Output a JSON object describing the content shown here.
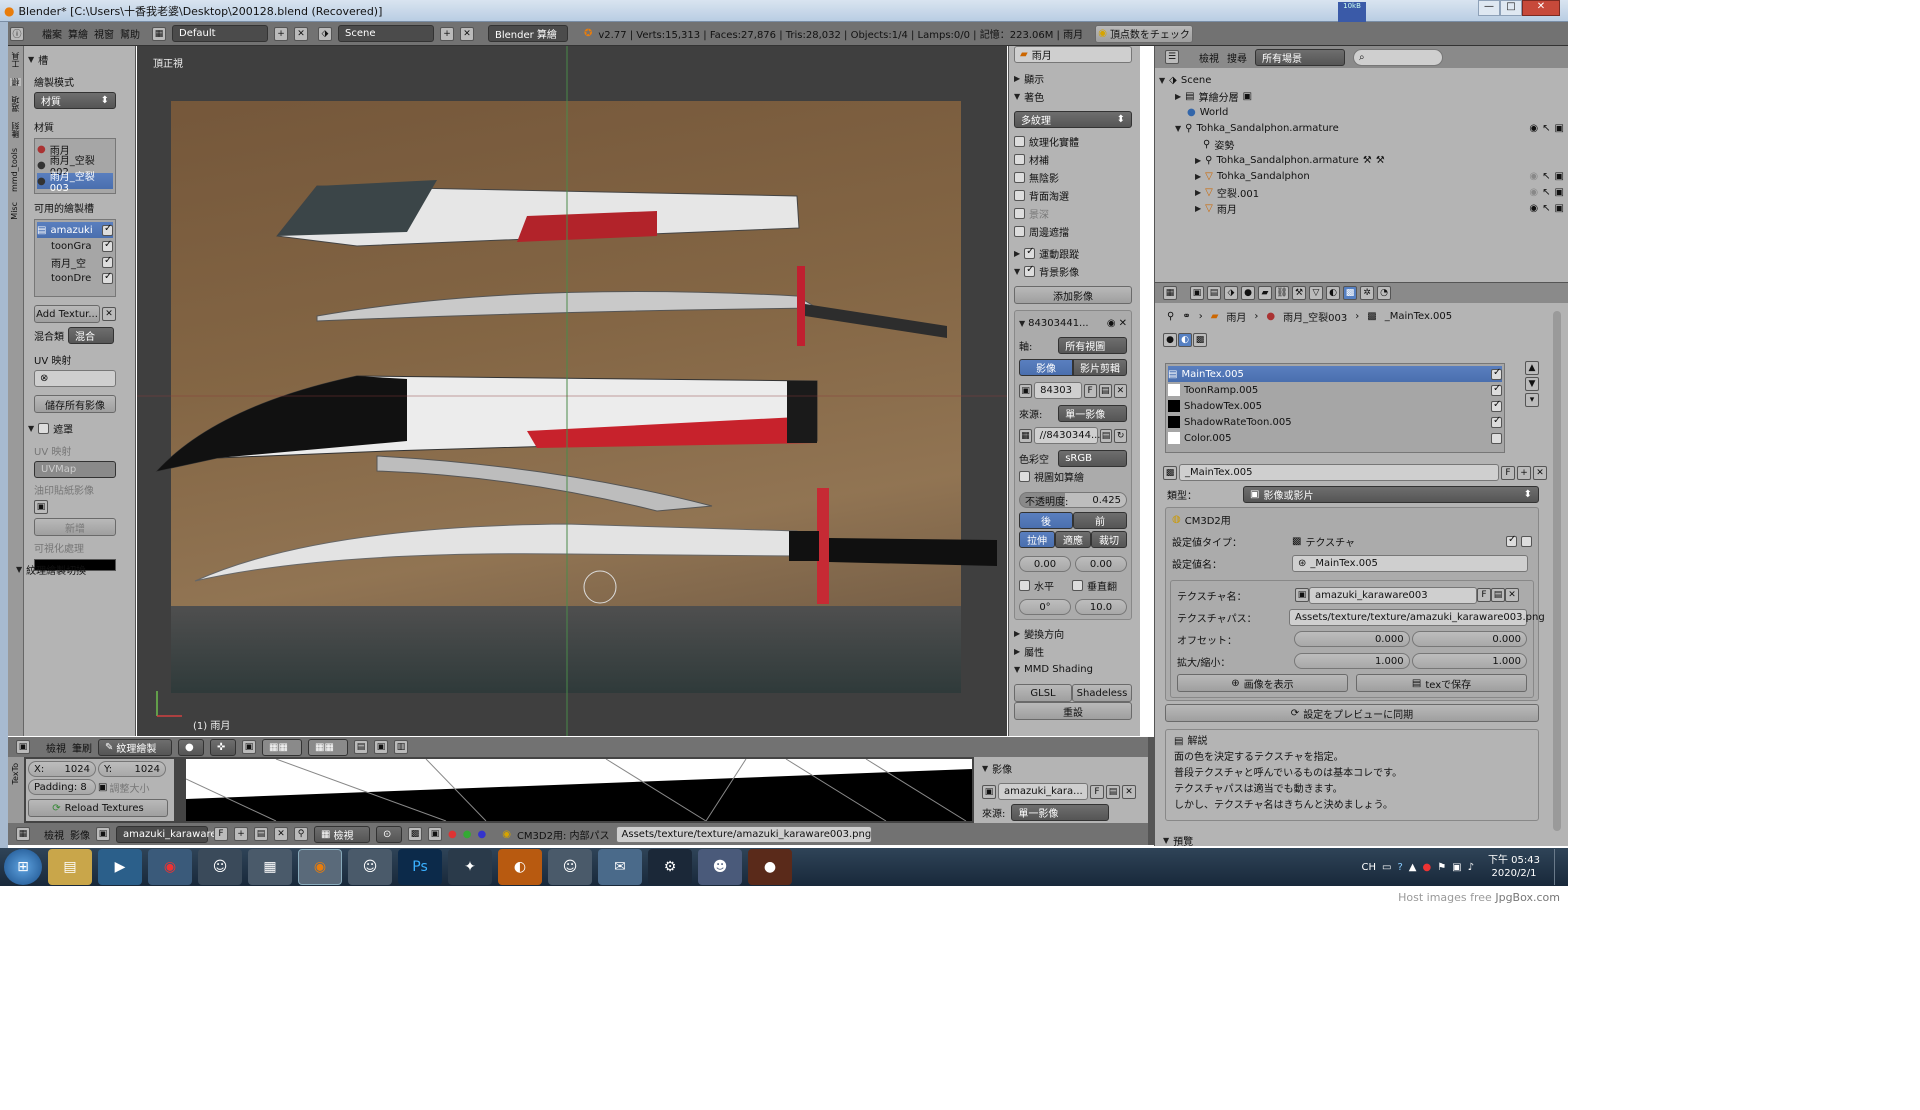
{
  "window": {
    "title": "Blender* [C:\\Users\\十香我老婆\\Desktop\\200128.blend (Recovered)]",
    "net_badge": "10kB"
  },
  "topbar": {
    "menus": [
      "檔案",
      "算繪",
      "視窗",
      "幫助"
    ],
    "layout": "Default",
    "scene": "Scene",
    "engine": "Blender 算繪",
    "stats": "v2.77 | Verts:15,313 | Faces:27,876 | Tris:28,032 | Objects:1/4 | Lamps:0/0 | 記憶：223.06M | 雨月",
    "check_btn": "頂点数をチェック"
  },
  "tool_tabs": [
    "工具",
    "標",
    "選項",
    "雕刻",
    "mmd_tools",
    "Misc"
  ],
  "left": {
    "slots_label": "槽",
    "paint_mode_label": "繪製模式",
    "paint_mode": "材質",
    "material_label": "材質",
    "materials": [
      "雨月",
      "雨月_空裂002",
      "雨月_空裂003"
    ],
    "paint_slots_label": "可用的繪製槽",
    "slots": [
      "amazuki",
      "toonGra",
      "雨月_空",
      "toonDre"
    ],
    "add_texture": "Add Textur...",
    "blend_label": "混合類",
    "blend_value": "混合",
    "uv_label": "UV 映射",
    "save_all": "儲存所有影像",
    "mask_label": "遮罩",
    "uv_map_label": "UV 映射",
    "uv_map_value": "UVMap",
    "stencil_label": "油印貼紙影像",
    "new_btn": "新增",
    "visualize_label": "可視化處理",
    "texture_switch": "紋理繪製切換"
  },
  "viewport": {
    "view_label": "頂正視",
    "object_label": "(1) 雨月"
  },
  "vbar": {
    "view": "檢視",
    "brush": "筆刷",
    "mode": "紋理繪製"
  },
  "props": {
    "material_top": "雨月",
    "display": "顯示",
    "shading": "著色",
    "shading_mode": "多紋理",
    "checks": [
      "紋理化實體",
      "材補",
      "無陰影",
      "背面淘選",
      "景深",
      "周邊遮擋"
    ],
    "motion_tracking": "運動跟蹤",
    "bg_images": "背景影像",
    "add_image": "添加影像",
    "img_name": "84303441...",
    "axis_label": "軸:",
    "axis_value": "所有視圖",
    "tab_image": "影像",
    "tab_clip": "影片剪輯",
    "img_field": "84303",
    "source_label": "來源:",
    "source_value": "單一影像",
    "path": "//8430344...",
    "colorspace_label": "色彩空",
    "colorspace_value": "sRGB",
    "view_as_render": "視圖如算繪",
    "opacity_label": "不透明度:",
    "opacity": "0.425",
    "back": "後",
    "front": "前",
    "stretch": "拉伸",
    "fit": "適應",
    "crop": "裁切",
    "x_off": "0.00",
    "y_off": "0.00",
    "flip_h": "水平",
    "flip_v": "垂直翻",
    "rotation": "0°",
    "size": "10.0",
    "transform": "變換方向",
    "properties": "屬性",
    "mmd_shading": "MMD Shading",
    "glsl": "GLSL",
    "shadeless": "Shadeless",
    "reset": "重設"
  },
  "outliner": {
    "view": "檢視",
    "search": "搜尋",
    "filter": "所有場景",
    "items": [
      "Scene",
      "算繪分層",
      "World",
      "Tohka_Sandalphon.armature",
      "姿勢",
      "Tohka_Sandalphon.armature",
      "Tohka_Sandalphon",
      "空裂.001",
      "雨月"
    ]
  },
  "texprops": {
    "breadcrumb": [
      "雨月",
      "雨月_空裂003",
      "_MainTex.005"
    ],
    "slots": [
      "MainTex.005",
      "ToonRamp.005",
      "ShadowTex.005",
      "ShadowRateToon.005",
      "Color.005"
    ],
    "tex_name": "_MainTex.005",
    "type_label": "類型：",
    "type_value": "影像或影片",
    "cm3d2_title": "CM3D2用",
    "setting_type_label": "設定値タイプ：",
    "setting_type_value": "テクスチャ",
    "setting_name_label": "設定値名：",
    "setting_name_value": "_MainTex.005",
    "tex_name_label": "テクスチャ名：",
    "tex_name_value": "amazuki_karaware003",
    "tex_path_label": "テクスチャパス：",
    "tex_path_value": "Assets/texture/texture/amazuki_karaware003.png",
    "offset_label": "オフセット：",
    "offset_x": "0.000",
    "offset_y": "0.000",
    "scale_label": "拡大/縮小：",
    "scale_x": "1.000",
    "scale_y": "1.000",
    "show_image": "画像を表示",
    "save_tex": "texで保存",
    "sync_preview": "設定をプレビューに同期",
    "help_title": "解説",
    "help_lines": [
      "面の色を決定するテクスチャを指定。",
      "普段テクスチャと呼んでいるものは基本コレです。",
      "テクスチャパスは適当でも動きます。",
      "しかし、テクスチャ名はきちんと決めましょう。"
    ],
    "preview": "預覽"
  },
  "uv": {
    "x": "1024",
    "y": "1024",
    "padding": "Padding: 8",
    "resize": "調整大小",
    "reload": "Reload Textures",
    "image_label": "影像",
    "image_name": "amazuki_kara...",
    "source_label": "來源:",
    "source_value": "單一影像",
    "side_tab": "TexTo"
  },
  "bottombar": {
    "view": "檢視",
    "image": "影像",
    "image_name": "amazuki_karaware...",
    "view2": "檢視",
    "cm3d2": "CM3D2用: 内部パス",
    "path": "Assets/texture/texture/amazuki_karaware003.png"
  },
  "taskbar": {
    "time": "下午 05:43",
    "date": "2020/2/1",
    "lang": "CH"
  },
  "footer": {
    "credit_prefix": "Host images free",
    "credit_site": "JpgBox.com"
  },
  "colors": {
    "panel": "#b4b4b4",
    "dark": "#3d3d3d",
    "header": "#727272",
    "select": "#5680c2",
    "taskbar": "#1b2a3a"
  }
}
